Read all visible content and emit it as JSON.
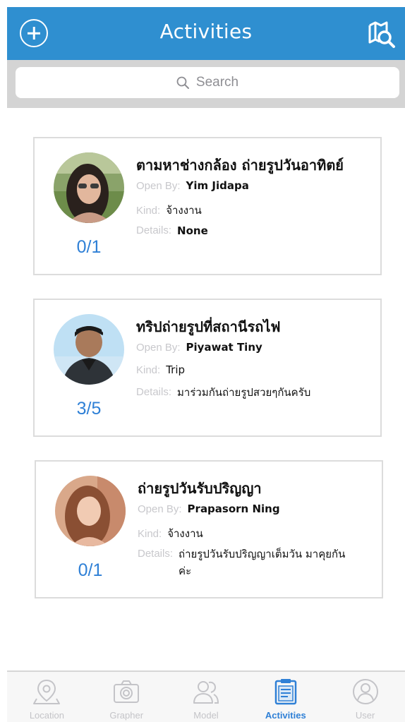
{
  "header": {
    "title": "Activities",
    "add_icon": "plus-circle-icon",
    "right_icon": "map-search-icon"
  },
  "search": {
    "placeholder": "Search",
    "icon": "magnifier-icon"
  },
  "activities": [
    {
      "title": "ตามหาช่างกล้อง ถ่ายรูปวันอาทิตย์",
      "open_by_label": "Open By:",
      "open_by": "Yim Jidapa",
      "kind_label": "Kind:",
      "kind": "จ้างงาน",
      "details_label": "Details:",
      "details": "None",
      "count": "0/1"
    },
    {
      "title": "ทริปถ่ายรูปที่สถานีรถไฟ",
      "open_by_label": "Open By:",
      "open_by": "Piyawat Tiny",
      "kind_label": "Kind:",
      "kind": "Trip",
      "details_label": "Details:",
      "details": "มาร่วมกันถ่ายรูปสวยๆกันครับ",
      "count": "3/5"
    },
    {
      "title": "ถ่ายรูปวันรับปริญญา",
      "open_by_label": "Open By:",
      "open_by": "Prapasorn Ning",
      "kind_label": "Kind:",
      "kind": "จ้างงาน",
      "details_label": "Details:",
      "details": "ถ่ายรูปวันรับปริญญาเต็มวัน มาคุยกันค่ะ",
      "count": "0/1"
    }
  ],
  "tabbar": {
    "tabs": [
      {
        "label": "Location",
        "icon": "map-pin-icon",
        "active": false
      },
      {
        "label": "Grapher",
        "icon": "camera-icon",
        "active": false
      },
      {
        "label": "Model",
        "icon": "people-icon",
        "active": false
      },
      {
        "label": "Activities",
        "icon": "clipboard-icon",
        "active": true
      },
      {
        "label": "User",
        "icon": "user-icon",
        "active": false
      }
    ]
  },
  "colors": {
    "primary": "#2f8fd0",
    "accent": "#2f80d6",
    "inactive": "#c4c4c8"
  }
}
